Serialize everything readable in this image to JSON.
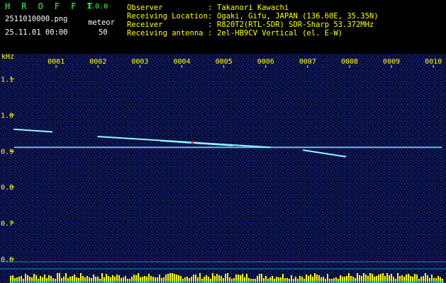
{
  "app": {
    "title": "H R O F F T",
    "version": "1.0.0"
  },
  "file": {
    "name": "2511010000.png",
    "timestamp": "25.11.01 00:00"
  },
  "meteor": {
    "label": "meteor",
    "count": "50"
  },
  "station": [
    {
      "key": "Observer",
      "sep": ":",
      "value": "Takanori Kawachi"
    },
    {
      "key": "Receiving Location",
      "sep": ":",
      "value": "Ogaki, Gifu, JAPAN (136.60E, 35.35N)"
    },
    {
      "key": "Receiver",
      "sep": ":",
      "value": "R820T2(RTL-SDR) SDR-Sharp 53.372MHz"
    },
    {
      "key": "Receiving antenna",
      "sep": ":",
      "value": "2el-HB9CV Vertical (el. E-W)"
    }
  ],
  "chart_data": {
    "type": "heatmap",
    "ylabel": "kHz",
    "y_ticks": [
      1.1,
      1.0,
      0.9,
      0.8,
      0.7,
      0.6
    ],
    "ylim": [
      0.58,
      1.17
    ],
    "x_ticks": [
      "0001",
      "0002",
      "0003",
      "0004",
      "0005",
      "0006",
      "0007",
      "0008",
      "0009",
      "0010"
    ],
    "xlim": [
      0,
      10.2
    ],
    "carrier_khz": 0.91,
    "echoes": [
      {
        "t0": 0.0,
        "t1": 0.9,
        "f0": 0.96,
        "f1": 0.953
      },
      {
        "t0": 2.0,
        "t1": 6.1,
        "f0": 0.94,
        "f1": 0.91
      },
      {
        "t0": 3.5,
        "t1": 5.2,
        "f0": 0.928,
        "f1": 0.915
      },
      {
        "t0": 6.9,
        "t1": 7.9,
        "f0": 0.902,
        "f1": 0.884
      }
    ],
    "colors": {
      "background": "#0a0f3c",
      "noise": "#1f3bd8",
      "carrier": "#5fd7ff",
      "echo": "#8cfbff",
      "hot": "#ff3030",
      "baseline": "#00e5ff",
      "meter": "#ffff00",
      "text": "#ffff00"
    }
  }
}
